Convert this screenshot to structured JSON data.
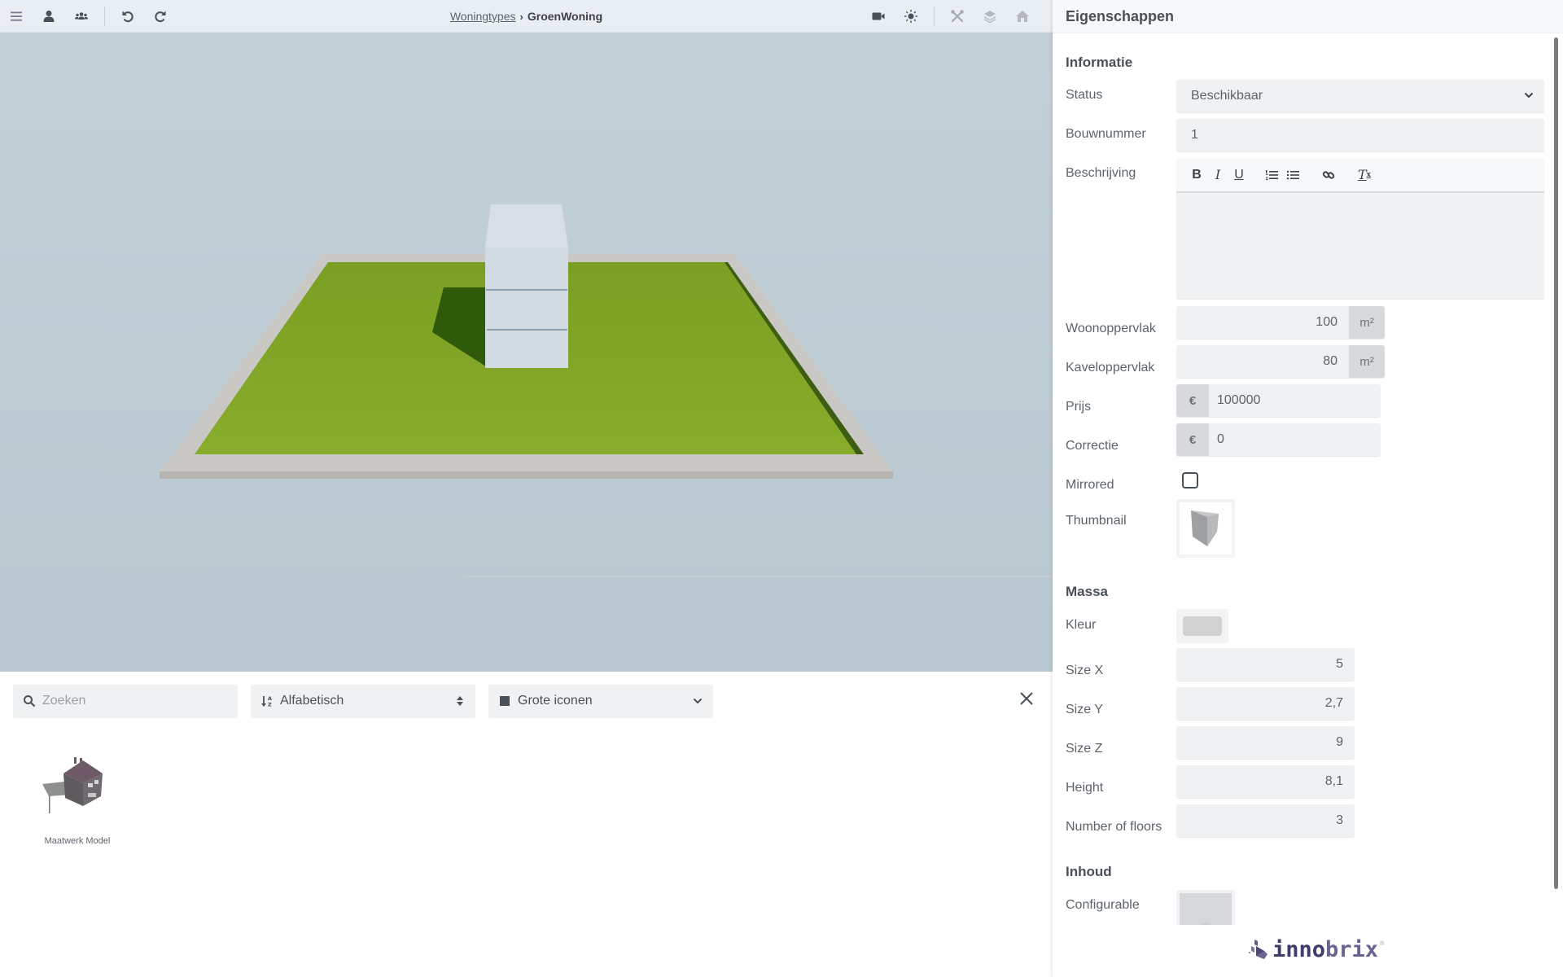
{
  "toolbar": {
    "left_icons": [
      "menu-icon",
      "user-icon",
      "users-icon",
      "undo-icon",
      "redo-icon"
    ],
    "breadcrumb": {
      "parent": "Woningtypes",
      "separator": "›",
      "current": "GroenWoning"
    },
    "right_icons": [
      "camera-icon",
      "sun-icon",
      "tools-icon",
      "layers-icon",
      "home-icon"
    ]
  },
  "viewport": {
    "scene": "3D lot with grass and mass box",
    "floors_visible": 3,
    "colors": {
      "sky": "#bccbd3",
      "grass": "#7fa428",
      "border": "#c8c8c6",
      "mass": "#d2dae2"
    }
  },
  "library": {
    "search": {
      "placeholder": "Zoeken",
      "value": ""
    },
    "sort": {
      "selected": "Alfabetisch"
    },
    "view": {
      "selected": "Grote iconen"
    },
    "items": [
      {
        "label": "Maatwerk Model"
      }
    ]
  },
  "panel": {
    "title": "Eigenschappen",
    "informatie": {
      "title": "Informatie",
      "status": {
        "label": "Status",
        "value": "Beschikbaar"
      },
      "bouwnummer": {
        "label": "Bouwnummer",
        "value": "1"
      },
      "beschrijving": {
        "label": "Beschrijving",
        "value": "",
        "tools": [
          "B",
          "I",
          "U",
          "ordered-list",
          "bullet-list",
          "link",
          "clear-format"
        ]
      },
      "woonoppervlak": {
        "label": "Woonoppervlak",
        "value": "100",
        "unit": "m²"
      },
      "kaveloppervlak": {
        "label": "Kaveloppervlak",
        "value": "80",
        "unit": "m²"
      },
      "prijs": {
        "label": "Prijs",
        "prefix": "€",
        "value": "100000"
      },
      "correctie": {
        "label": "Correctie",
        "prefix": "€",
        "value": "0"
      },
      "mirrored": {
        "label": "Mirrored",
        "checked": false
      },
      "thumbnail": {
        "label": "Thumbnail"
      }
    },
    "massa": {
      "title": "Massa",
      "kleur": {
        "label": "Kleur",
        "color": "#d2d2d2"
      },
      "size_x": {
        "label": "Size X",
        "value": "5"
      },
      "size_y": {
        "label": "Size Y",
        "value": "2,7"
      },
      "size_z": {
        "label": "Size Z",
        "value": "9"
      },
      "height": {
        "label": "Height",
        "value": "8,1"
      },
      "floors": {
        "label": "Number of floors",
        "value": "3"
      }
    },
    "inhoud": {
      "title": "Inhoud",
      "configurable": {
        "label": "Configurable"
      }
    }
  },
  "brand": {
    "name_a": "inno",
    "name_b": "brix",
    "color": "#3e3d6a"
  }
}
